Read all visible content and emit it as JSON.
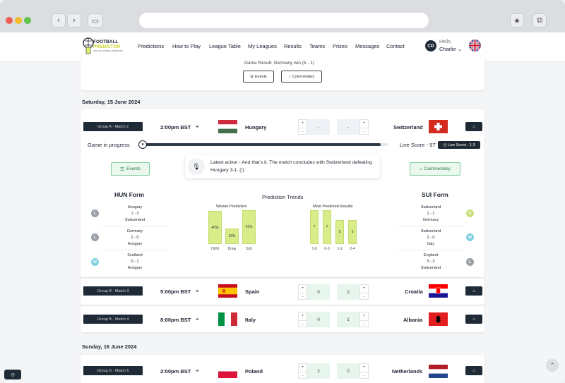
{
  "brand": {
    "name": "FOOTBALL",
    "name2": "PREDICTOR",
    "tagline": "OFFICIAL FOOTBALL PREDICTOR"
  },
  "nav": [
    "Predictions",
    "How to Play",
    "League Table",
    "My Leagues",
    "Results",
    "Teams",
    "Prizes",
    "Messages",
    "Contact"
  ],
  "user": {
    "initials": "CD",
    "hello": "Hello,",
    "name": "Charlie"
  },
  "prev_card": {
    "result": "Game Result: Germany win (5 - 1)",
    "events": "Events",
    "commentary": "Commentary"
  },
  "dates": [
    "Saturday, 15 June 2024",
    "Sunday, 16 June 2024"
  ],
  "matches": [
    {
      "tag": "Group A - Match 2",
      "time": "2:00pm BST",
      "home": "Hungary",
      "away": "Switzerland",
      "home_score": "-",
      "away_score": "-"
    },
    {
      "tag": "Group B - Match 3",
      "time": "5:00pm BST",
      "home": "Spain",
      "away": "Croatia",
      "home_score": "0",
      "away_score": "2"
    },
    {
      "tag": "Group B - Match 4",
      "time": "8:00pm BST",
      "home": "Italy",
      "away": "Albania",
      "home_score": "0",
      "away_score": "1"
    },
    {
      "tag": "Group D - Match 5",
      "time": "2:00pm BST",
      "home": "Poland",
      "away": "Netherlands",
      "home_score": "2",
      "away_score": "0"
    }
  ],
  "live": {
    "status": "Game in progress",
    "progress": 0.97,
    "live_score_text": "Live Score - 97'",
    "live_badge": "Live Score : 1-3",
    "latest": "Latest action - And that's it. The match concludes with Switzerland defeating Hungary 3-1. (!)",
    "events": "Events",
    "commentary": "Commentary"
  },
  "home_form": {
    "title": "HUN Form",
    "rows": [
      {
        "badge": "L",
        "color": "#9aa0a6",
        "line1": "Hungary",
        "line2": "1 - 3",
        "line3": "Switzerland"
      },
      {
        "badge": "L",
        "color": "#9aa0a6",
        "line1": "Germany",
        "line2": "2 - 0",
        "line3": "Hungary"
      },
      {
        "badge": "W",
        "color": "#7fd1e0",
        "line1": "Scotland",
        "line2": "0 - 1",
        "line3": "Hungary"
      }
    ]
  },
  "away_form": {
    "title": "SUI Form",
    "rows": [
      {
        "badge": "D",
        "color": "#c8e07a",
        "line1": "Switzerland",
        "line2": "1 - 1",
        "line3": "Germany"
      },
      {
        "badge": "W",
        "color": "#7fd1e0",
        "line1": "Switzerland",
        "line2": "2 - 0",
        "line3": "Italy"
      },
      {
        "badge": "L",
        "color": "#9aa0a6",
        "line1": "England",
        "line2": "5 - 3",
        "line3": "Switzerland"
      }
    ]
  },
  "trends": {
    "title": "Prediction Trends",
    "winner_title": "Winner Prediction",
    "results_title": "Most Predicted Results"
  },
  "chart_data": [
    {
      "type": "bar",
      "title": "Winner Prediction",
      "categories": [
        "HUN",
        "Draw",
        "SUI"
      ],
      "values": [
        40,
        19,
        41
      ],
      "labels": [
        "40%",
        "19%",
        "41%"
      ],
      "ylim": [
        0,
        41
      ]
    },
    {
      "type": "bar",
      "title": "Most Predicted Results",
      "categories": [
        "3-0",
        "0-3",
        "1-1",
        "2-4"
      ],
      "values": [
        7,
        7,
        5,
        5
      ],
      "labels": [
        "7",
        "7",
        "5",
        "5"
      ],
      "ylim": [
        0,
        7
      ]
    }
  ]
}
